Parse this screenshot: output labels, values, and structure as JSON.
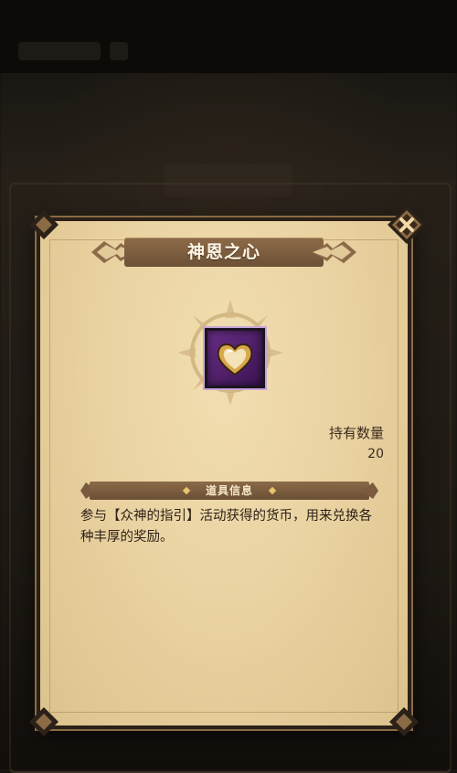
{
  "dialog": {
    "title": "神恩之心",
    "quantity_label": "持有数量",
    "quantity_value": "20",
    "section_title": "道具信息",
    "description": "参与【众神的指引】活动获得的货币，用来兑换各种丰厚的奖励。",
    "item_icon": "heart-gem-icon",
    "close_icon": "close-icon"
  },
  "colors": {
    "parchment": "#ead3a2",
    "header_brown": "#7a5b3e",
    "item_frame_purple": "#5a2575",
    "text_dark": "#2e2218"
  }
}
